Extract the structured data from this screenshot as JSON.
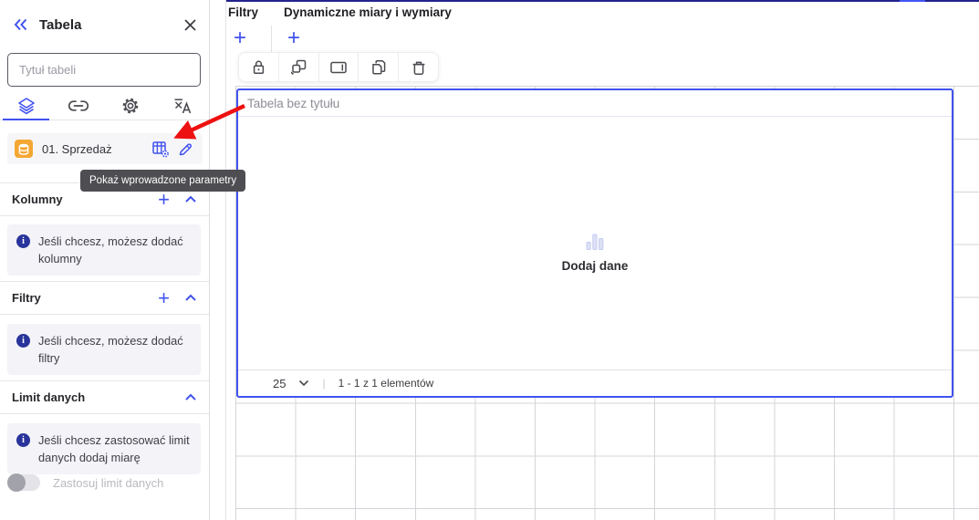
{
  "colors": {
    "accent": "#4152ee",
    "top_line": "#23238d",
    "arrow_red": "#ee1111",
    "dataset_orange": "#f5a733",
    "info_icon": "#28339b"
  },
  "symbols": {
    "plus": "+",
    "pagination_separator": "|"
  },
  "sidebar": {
    "title": "Tabela",
    "title_input": {
      "placeholder": "Tytuł tabeli",
      "value": ""
    },
    "tabs": [
      "layers",
      "link",
      "settings",
      "translate"
    ],
    "active_tab": "layers",
    "dataset": {
      "label": "01. Sprzedaż",
      "icons": [
        "dataset-source-icon",
        "show-parameters-icon",
        "edit-icon"
      ]
    },
    "tooltip": "Pokaż wprowadzone parametry",
    "sections": [
      {
        "title": "Kolumny",
        "info": "Jeśli chcesz, możesz dodać kolumny"
      },
      {
        "title": "Filtry",
        "info": "Jeśli chcesz, możesz dodać filtry"
      },
      {
        "title": "Limit danych",
        "info": "Jeśli chcesz zastosować limit danych dodaj miarę",
        "toggle_label": "Zastosuj limit danych",
        "toggle_state": "off"
      }
    ]
  },
  "canvas": {
    "filters_header": "Filtry",
    "dynamic_header": "Dynamiczne miary i wymiary",
    "toolbar_icons": [
      "lock",
      "swap-widget",
      "panel-right",
      "copy",
      "delete"
    ],
    "widget": {
      "title": "Tabela bez tytułu",
      "empty_icon": "bar-chart",
      "empty_label": "Dodaj dane",
      "pagination": {
        "page_size": "25",
        "range": "1 - 1 z 1 elementów"
      }
    }
  }
}
